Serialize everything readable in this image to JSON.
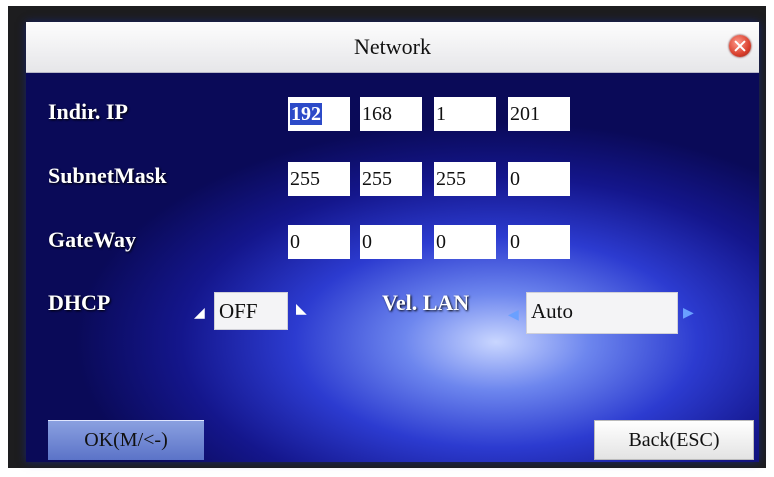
{
  "window": {
    "title": "Network"
  },
  "fields": {
    "ip": {
      "label": "Indir. IP",
      "octets": [
        "192",
        "168",
        "1",
        "201"
      ]
    },
    "subnet": {
      "label": "SubnetMask",
      "octets": [
        "255",
        "255",
        "255",
        "0"
      ]
    },
    "gateway": {
      "label": "GateWay",
      "octets": [
        "0",
        "0",
        "0",
        "0"
      ]
    },
    "dhcp": {
      "label": "DHCP",
      "value": "OFF"
    },
    "lan": {
      "label": "Vel. LAN",
      "value": "Auto"
    }
  },
  "buttons": {
    "ok": "OK(M/<-)",
    "back": "Back(ESC)"
  },
  "colors": {
    "screen_bg": "#14168c",
    "titlebar": "#f2f2f4",
    "selection": "#2c4ac8"
  },
  "icons": {
    "close": "close-icon",
    "left": "arrow-left-icon",
    "right": "arrow-right-icon"
  }
}
